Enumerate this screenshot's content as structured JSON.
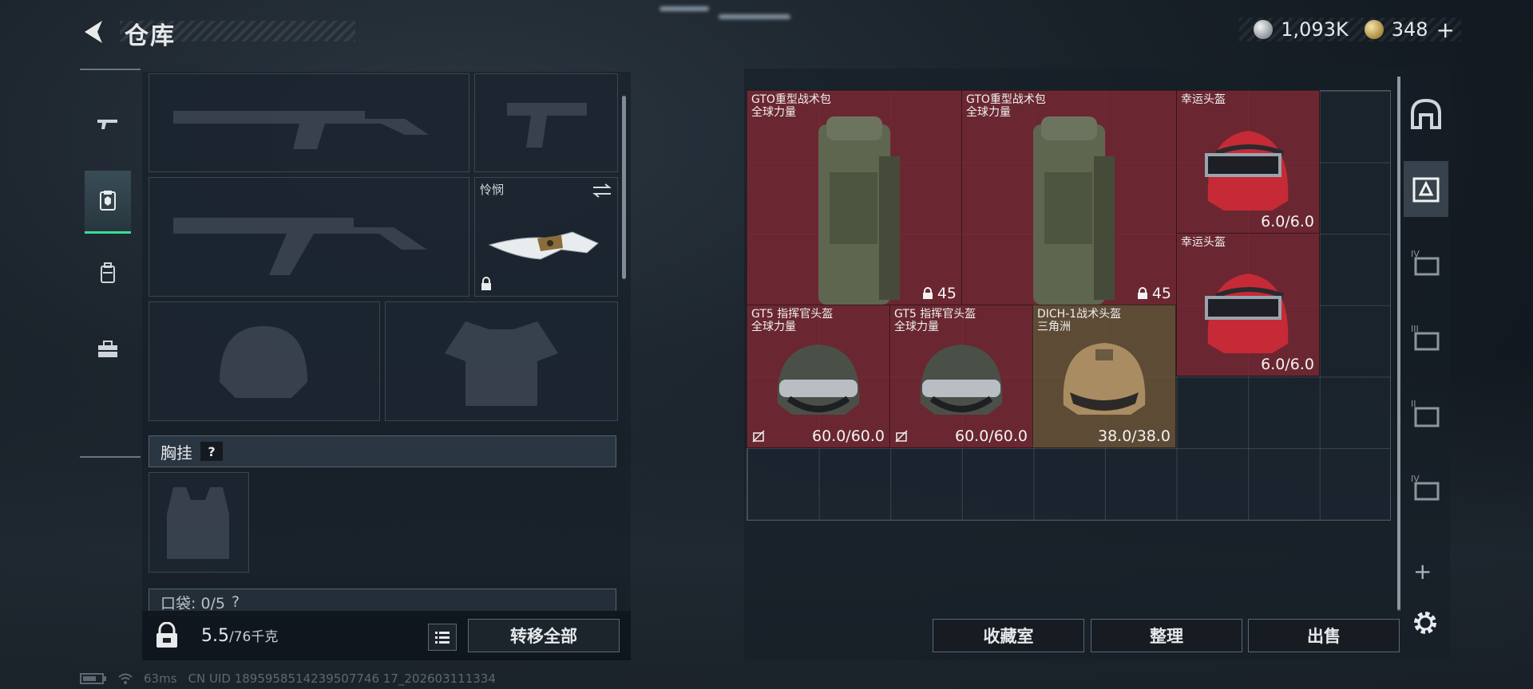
{
  "header": {
    "title": "仓库",
    "currency_silver": "1,093K",
    "currency_gold": "348",
    "currency_plus": "+"
  },
  "nav": {
    "items": [
      "gun-icon",
      "armor-card-icon",
      "backpack-icon",
      "toolbox-icon"
    ],
    "active_index": 1
  },
  "equipment": {
    "melee_name": "怜悯",
    "chest_label": "胸挂",
    "chest_help": "?",
    "pocket_label": "口袋: 0/5",
    "pocket_help": "?"
  },
  "weight": {
    "value": "5.5",
    "max": "/76千克"
  },
  "buttons": {
    "transfer_all": "转移全部",
    "collection": "收藏室",
    "organize": "整理",
    "sell": "出售"
  },
  "stash_items": [
    {
      "name": "GTO重型战术包\n全球力量",
      "value": "45",
      "kind": "backpack"
    },
    {
      "name": "GTO重型战术包\n全球力量",
      "value": "45",
      "kind": "backpack"
    },
    {
      "name": "幸运头盔",
      "value": "6.0/6.0",
      "kind": "red-helmet"
    },
    {
      "name": "幸运头盔",
      "value": "6.0/6.0",
      "kind": "red-helmet"
    },
    {
      "name": "GT5 指挥官头盔\n全球力量",
      "value": "60.0/60.0",
      "kind": "helmet"
    },
    {
      "name": "GT5 指挥官头盔\n全球力量",
      "value": "60.0/60.0",
      "kind": "helmet"
    },
    {
      "name": "DICH-1战术头盔\n三角洲",
      "value": "38.0/38.0",
      "kind": "tan-helmet"
    }
  ],
  "side_tabs": [
    "home-icon",
    "stash-tab-icon",
    "stash-tab-iv-icon",
    "stash-tab-iii-icon",
    "stash-tab-ii-icon",
    "stash-tab-iv-2-icon"
  ],
  "side_tab_labels": [
    "IV",
    "III",
    "II",
    "IV"
  ],
  "footer": {
    "ping": "63ms",
    "uid": "CN UID 1895958514239507746 17_202603111334"
  },
  "colors": {
    "accent_green": "#3ddc97",
    "item_red": "#7c2832",
    "item_tan": "#6e5438"
  }
}
